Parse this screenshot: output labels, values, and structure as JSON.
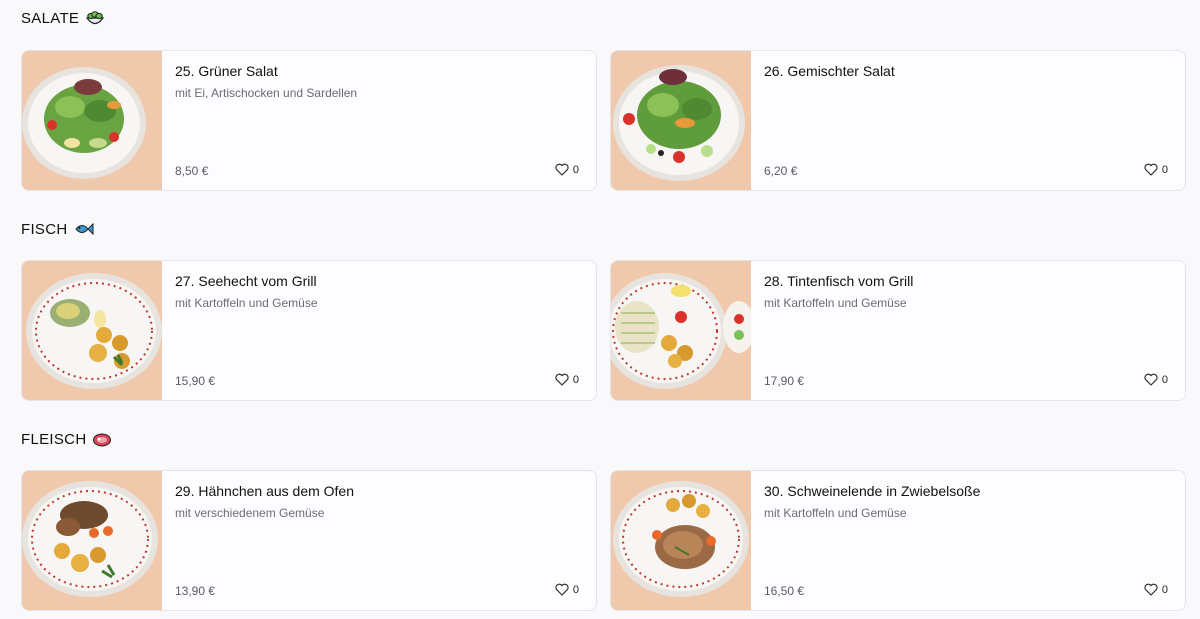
{
  "sections": [
    {
      "title": "SALATE",
      "emoji": "salad-icon",
      "items": [
        {
          "name": "25. Grüner Salat",
          "description": "mit Ei, Artischocken und Sardellen",
          "price": "8,50 €",
          "likes": "0",
          "photo": "salad-photo"
        },
        {
          "name": "26. Gemischter Salat",
          "description": "",
          "price": "6,20 €",
          "likes": "0",
          "photo": "salad-photo"
        }
      ]
    },
    {
      "title": "FISCH",
      "emoji": "fish-icon",
      "items": [
        {
          "name": "27. Seehecht vom Grill",
          "description": "mit Kartoffeln und Gemüse",
          "price": "15,90 €",
          "likes": "0",
          "photo": "fish-dish-photo"
        },
        {
          "name": "28. Tintenfisch vom Grill",
          "description": "mit Kartoffeln und Gemüse",
          "price": "17,90 €",
          "likes": "0",
          "photo": "squid-dish-photo"
        }
      ]
    },
    {
      "title": "FLEISCH",
      "emoji": "meat-icon",
      "items": [
        {
          "name": "29. Hähnchen aus dem Ofen",
          "description": "mit verschiedenem Gemüse",
          "price": "13,90 €",
          "likes": "0",
          "photo": "chicken-dish-photo"
        },
        {
          "name": "30. Schweinelende in Zwiebelsoße",
          "description": "mit Kartoffeln und Gemüse",
          "price": "16,50 €",
          "likes": "0",
          "photo": "pork-dish-photo"
        }
      ]
    }
  ],
  "colors": {
    "background": "#f9f9fb",
    "card_border": "#e4e4ea",
    "photo_backdrop": "#f2cdb2"
  }
}
